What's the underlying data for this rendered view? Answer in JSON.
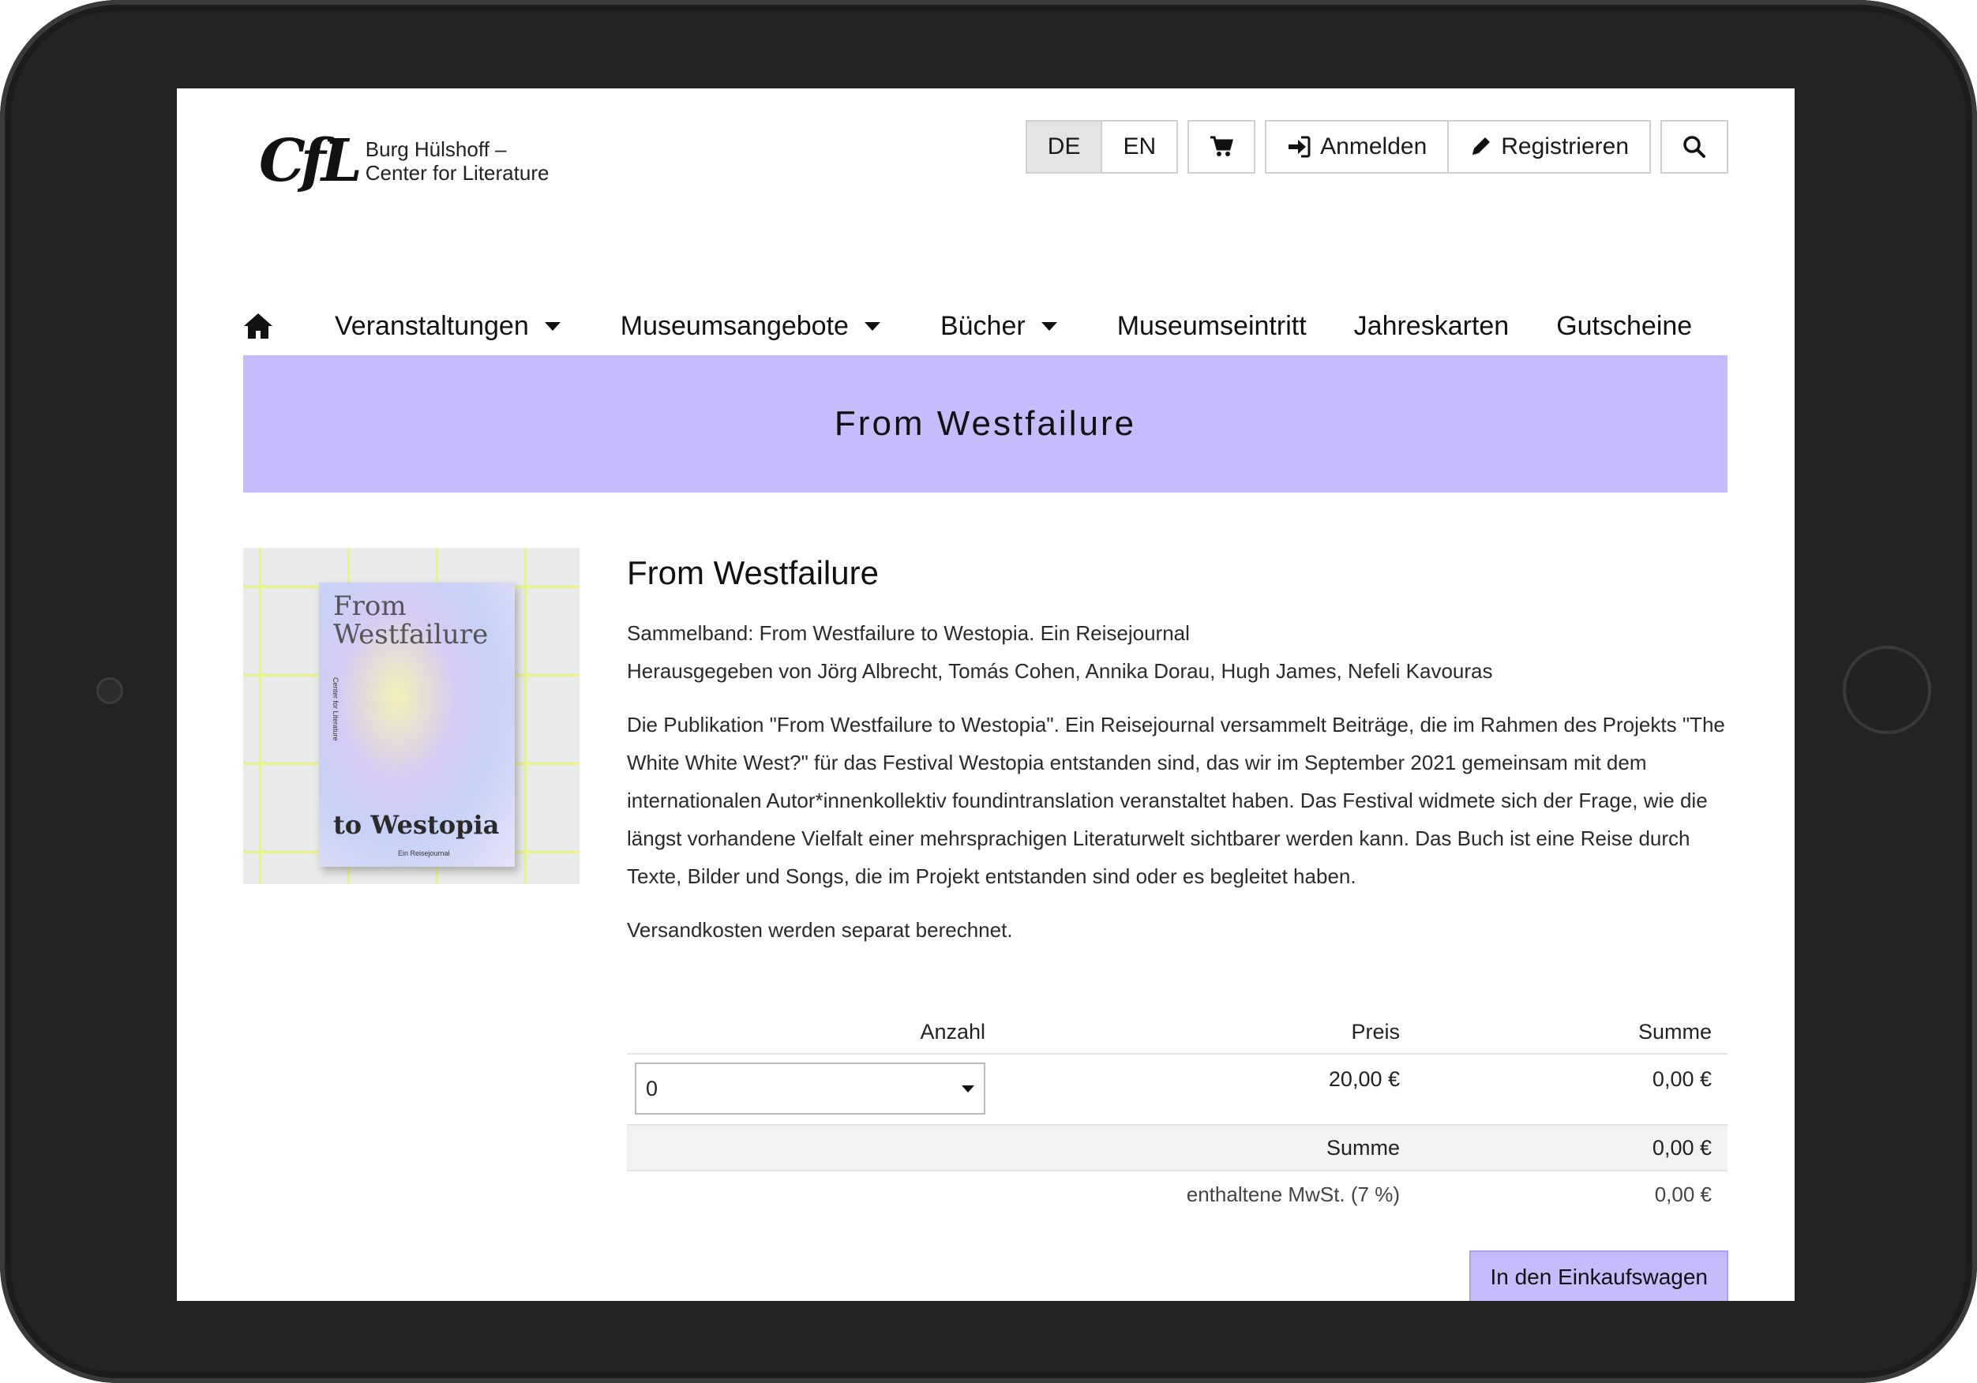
{
  "header": {
    "logo_mark": "CfL",
    "logo_line1": "Burg Hülshoff –",
    "logo_line2": "Center for Literature",
    "lang_de": "DE",
    "lang_en": "EN",
    "login_label": "Anmelden",
    "register_label": "Registrieren"
  },
  "nav": {
    "items": [
      {
        "label": "Veranstaltungen",
        "dropdown": true
      },
      {
        "label": "Museumsangebote",
        "dropdown": true
      },
      {
        "label": "Bücher",
        "dropdown": true
      },
      {
        "label": "Museumseintritt",
        "dropdown": false
      },
      {
        "label": "Jahreskarten",
        "dropdown": false
      },
      {
        "label": "Gutscheine",
        "dropdown": false
      }
    ]
  },
  "banner": {
    "title": "From Westfailure"
  },
  "product": {
    "cover": {
      "title_top": "From\nWestfailure",
      "title_bottom": "to Westopia",
      "subtitle": "Ein Reisejournal",
      "spine": "Center for Literature"
    },
    "title": "From Westfailure",
    "subtitle": "Sammelband: From Westfailure to Westopia. Ein Reisejournal",
    "editors": "Herausgegeben von Jörg Albrecht, Tomás Cohen, Annika Dorau, Hugh James, Nefeli Kavouras",
    "description": "Die Publikation \"From Westfailure to Westopia\". Ein Reisejournal versammelt Beiträge, die im Rahmen des Projekts \"The White White West?\" für das Festival Westopia entstanden sind, das wir im September 2021 gemeinsam mit dem internationalen Autor*innenkollektiv foundintranslation veranstaltet haben. Das Festival widmete sich der Frage, wie die längst vorhandene Vielfalt einer mehrsprachigen Literaturwelt sichtbarer werden kann. Das Buch ist eine Reise durch Texte, Bilder und Songs, die im Projekt entstanden sind oder es begleitet haben.",
    "shipping": "Versandkosten werden separat berechnet."
  },
  "table": {
    "headers": {
      "quantity": "Anzahl",
      "price": "Preis",
      "total": "Summe"
    },
    "row": {
      "quantity": "0",
      "price": "20,00 €",
      "total": "0,00 €"
    },
    "sum_label": "Summe",
    "sum_value": "0,00 €",
    "vat_label": "enthaltene MwSt. (7 %)",
    "vat_value": "0,00 €"
  },
  "actions": {
    "add_to_cart": "In den Einkaufswagen"
  },
  "colors": {
    "accent": "#c4bcfb",
    "frame": "#232323"
  }
}
